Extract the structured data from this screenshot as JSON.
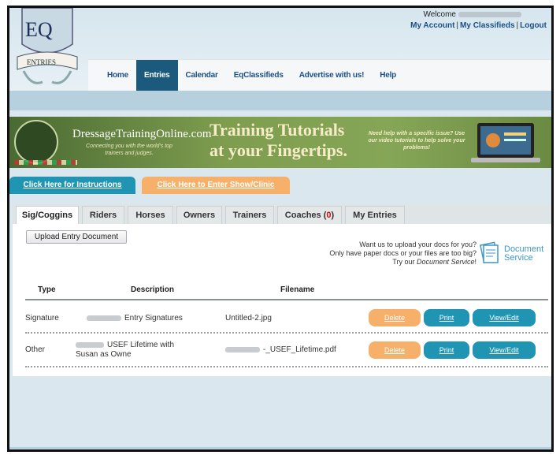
{
  "header": {
    "logo_text": "EQ",
    "logo_ribbon": "ENTRIES",
    "welcome": "Welcome",
    "account_links": [
      "My Account",
      "My Classifieds",
      "Logout"
    ]
  },
  "nav": {
    "items": [
      "Home",
      "Entries",
      "Calendar",
      "EqClassifieds",
      "Advertise with us!",
      "Help"
    ],
    "active": "Entries"
  },
  "banner": {
    "brand": "DressageTrainingOnline.com",
    "tagline": "Connecting you with the world's top trainers and judges.",
    "title_line1": "Training Tutorials",
    "title_line2": "at your Fingertips.",
    "help_text": "Need help with a specific issue? Use our video tutorials to help solve your problems!"
  },
  "cta": {
    "instructions": "Click Here for Instructions",
    "enter_show": "Click Here to Enter Show/Clinic"
  },
  "tabs": [
    {
      "label": "Sig/Coggins",
      "active": true
    },
    {
      "label": "Riders"
    },
    {
      "label": "Horses"
    },
    {
      "label": "Owners"
    },
    {
      "label": "Trainers"
    },
    {
      "label": "Coaches",
      "count": "0"
    },
    {
      "label": "My Entries"
    }
  ],
  "panel": {
    "upload_label": "Upload Entry Document",
    "doc_service_line1": "Want us to upload your docs for you?",
    "doc_service_line2": "Only have paper docs or your files are too big?",
    "doc_service_line3_prefix": "Try our ",
    "doc_service_line3_em": "Document Service",
    "doc_service_line3_suffix": "!",
    "doc_service_label_1": "Document",
    "doc_service_label_2": "Service"
  },
  "table": {
    "headers": {
      "type": "Type",
      "description": "Description",
      "filename": "Filename"
    },
    "rows": [
      {
        "type": "Signature",
        "description": "Entry Signatures",
        "filename": "Untitled-2.jpg",
        "delete": "Delete",
        "print": "Print",
        "view": "View/Edit"
      },
      {
        "type": "Other",
        "description": "USEF Lifetime with Susan as Owne",
        "filename": "-_USEF_Lifetime.pdf",
        "delete": "Delete",
        "print": "Print",
        "view": "View/Edit"
      }
    ]
  },
  "colors": {
    "nav_active": "#1b5a7c",
    "link": "#1b4f86",
    "teal_button": "#1f94b3",
    "orange_button": "#f7b06a",
    "coaches_count": "#cc1111"
  }
}
